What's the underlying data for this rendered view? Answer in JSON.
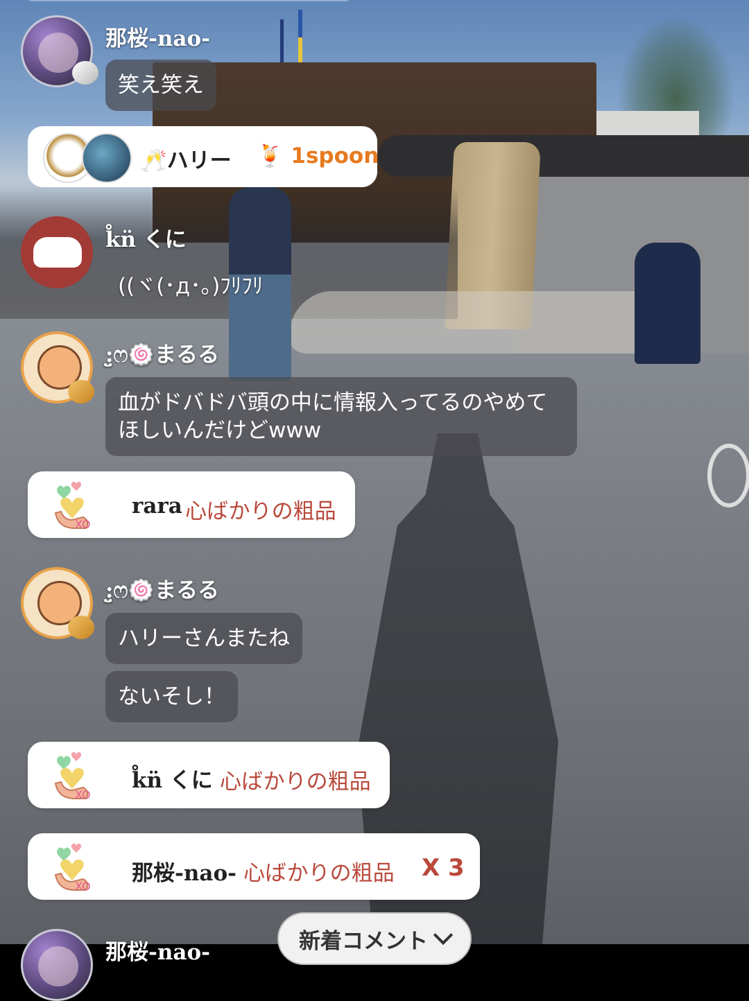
{
  "messages": [
    {
      "user": "那桜-nao-",
      "avatar": "nao-avatar",
      "lines": [
        "笑え笑え"
      ]
    },
    {
      "user": "k̊n̈ くに",
      "avatar": "kuni-avatar",
      "lines": [
        "((ヾ(･д･｡)ﾌﾘﾌﾘ"
      ]
    },
    {
      "user": ":̤̮ෆ🍥まるる",
      "avatar": "maruru-avatar",
      "lines": [
        "血がドバドバ頭の中に情報入ってるのやめて\nほしいんだけどwww"
      ]
    },
    {
      "user": ":̤̮ෆ🍥まるる",
      "avatar": "maruru-avatar",
      "lines": [
        "ハリーさんまたね",
        "ないそし！"
      ]
    },
    {
      "user": "那桜-nao-",
      "avatar": "nao-avatar",
      "lines": []
    }
  ],
  "harry_card": {
    "name": "🥂ハリー",
    "item": "🍹 1spoon"
  },
  "gifts": [
    {
      "user": "rara",
      "item": "心ばかりの粗品",
      "count": ""
    },
    {
      "user": "k̊n̈ くに",
      "item": "心ばかりの粗品",
      "count": ""
    },
    {
      "user": "那桜-nao-",
      "item": "心ばかりの粗品",
      "count": "X 3"
    }
  ],
  "new_comment_button": {
    "label": "新着コメント"
  },
  "icons": {
    "gift": "heart-hand-gift-icon",
    "chevron": "chevron-down-icon",
    "badge_gold": "gold-wing-badge-icon",
    "badge_silver": "silver-wing-badge-icon"
  },
  "colors": {
    "gift_text": "#b9493b",
    "spoon_text": "#e77a1f",
    "bubble_bg": "rgba(75,75,80,0.72)"
  }
}
